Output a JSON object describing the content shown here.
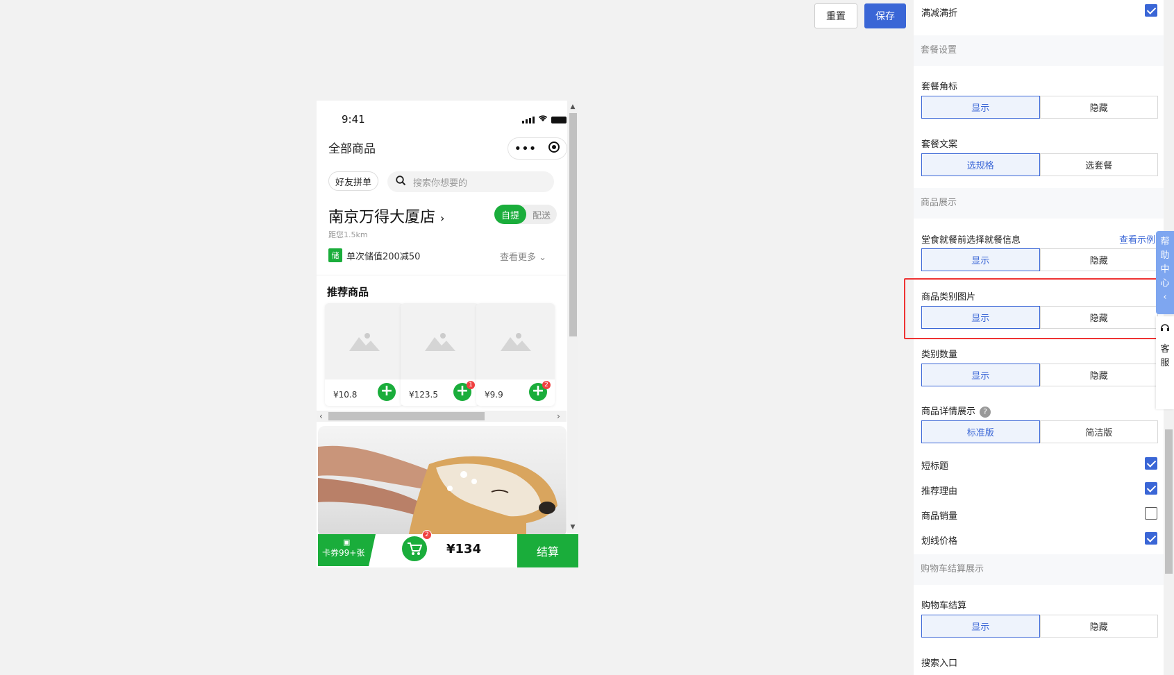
{
  "toolbar": {
    "reset_label": "重置",
    "save_label": "保存"
  },
  "phone": {
    "time": "9:41",
    "title": "全部商品",
    "friend_btn": "好友拼单",
    "search_placeholder": "搜索你想要的",
    "store_name": "南京万得大厦店",
    "distance": "距您1.5km",
    "toggle": {
      "active": "自提",
      "inactive": "配送"
    },
    "promo_tag": "储",
    "promo_text": "单次储值200减50",
    "more_label": "查看更多",
    "recommend_title": "推荐商品",
    "products": [
      {
        "price": "¥10.8",
        "badge": ""
      },
      {
        "price": "¥123.5",
        "badge": "1"
      },
      {
        "price": "¥9.9",
        "badge": "2"
      }
    ],
    "bottom": {
      "coupon_text": "卡券99+张",
      "cart_badge": "2",
      "total": "¥134",
      "checkout": "结算"
    }
  },
  "settings": {
    "full_reduction": {
      "label": "满减满折",
      "checked": true
    },
    "section_combo": "套餐设置",
    "combo_badge": {
      "label": "套餐角标",
      "options": [
        "显示",
        "隐藏"
      ],
      "selected": "显示"
    },
    "combo_text": {
      "label": "套餐文案",
      "options": [
        "选规格",
        "选套餐"
      ],
      "selected": "选规格"
    },
    "section_display": "商品展示",
    "dine_info": {
      "label": "堂食就餐前选择就餐信息",
      "link": "查看示例",
      "options": [
        "显示",
        "隐藏"
      ],
      "selected": "显示"
    },
    "category_image": {
      "label": "商品类别图片",
      "options": [
        "显示",
        "隐藏"
      ],
      "selected": "显示"
    },
    "category_count": {
      "label": "类别数量",
      "options": [
        "显示",
        "隐藏"
      ],
      "selected": "显示"
    },
    "detail_display": {
      "label": "商品详情展示",
      "help": "?",
      "options": [
        "标准版",
        "简洁版"
      ],
      "selected": "标准版"
    },
    "short_title": {
      "label": "短标题",
      "checked": true
    },
    "reason": {
      "label": "推荐理由",
      "checked": true
    },
    "sales": {
      "label": "商品销量",
      "checked": false
    },
    "strike_price": {
      "label": "划线价格",
      "checked": true
    },
    "section_cart": "购物车结算展示",
    "cart_checkout": {
      "label": "购物车结算",
      "options": [
        "显示",
        "隐藏"
      ],
      "selected": "显示"
    },
    "search_entry": {
      "label": "搜索入口"
    }
  },
  "side": {
    "help_center": "帮助中心",
    "service": "客服"
  },
  "colors": {
    "accent": "#3a66d6",
    "green": "#1aad3b",
    "highlight": "#ee3333"
  }
}
